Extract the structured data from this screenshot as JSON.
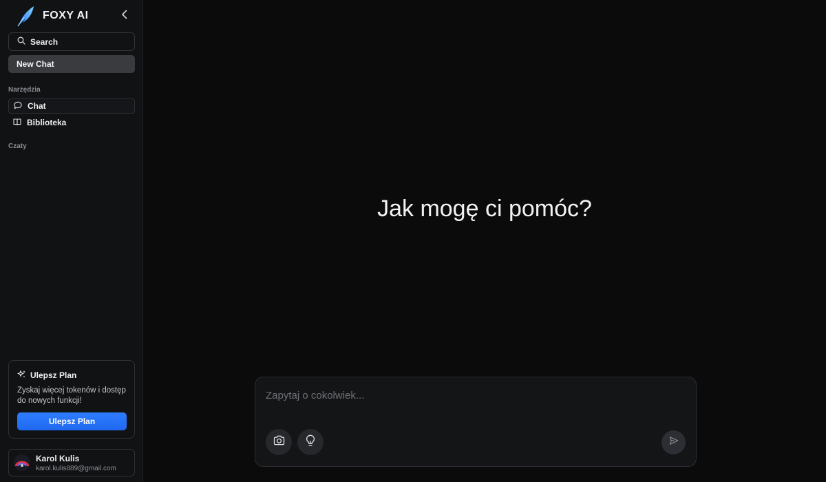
{
  "brand": {
    "name": "FOXY AI",
    "logo_icon": "feather-logo-icon"
  },
  "sidebar": {
    "search_label": "Search",
    "new_chat_label": "New Chat",
    "tools_section": "Narzędzia",
    "nav": [
      {
        "label": "Chat",
        "icon": "chat-bubble-icon",
        "active": true
      },
      {
        "label": "Biblioteka",
        "icon": "book-icon",
        "active": false
      }
    ],
    "chats_section": "Czaty",
    "upgrade": {
      "title": "Ulepsz Plan",
      "description": "Zyskaj więcej tokenów i dostęp do nowych funkcji!",
      "button_label": "Ulepsz Plan"
    },
    "user": {
      "name": "Karol Kulis",
      "email": "karol.kulis889@gmail.com"
    }
  },
  "main": {
    "headline": "Jak mogę ci pomóc?",
    "composer": {
      "placeholder": "Zapytaj o cokolwiek...",
      "value": "",
      "buttons": [
        "camera-icon",
        "lightbulb-icon",
        "send-icon"
      ]
    }
  },
  "colors": {
    "background": "#0b0b0c",
    "sidebar": "#111214",
    "accent": "#2f7dff",
    "text": "#f2f2f2",
    "muted": "#8b8d93"
  }
}
